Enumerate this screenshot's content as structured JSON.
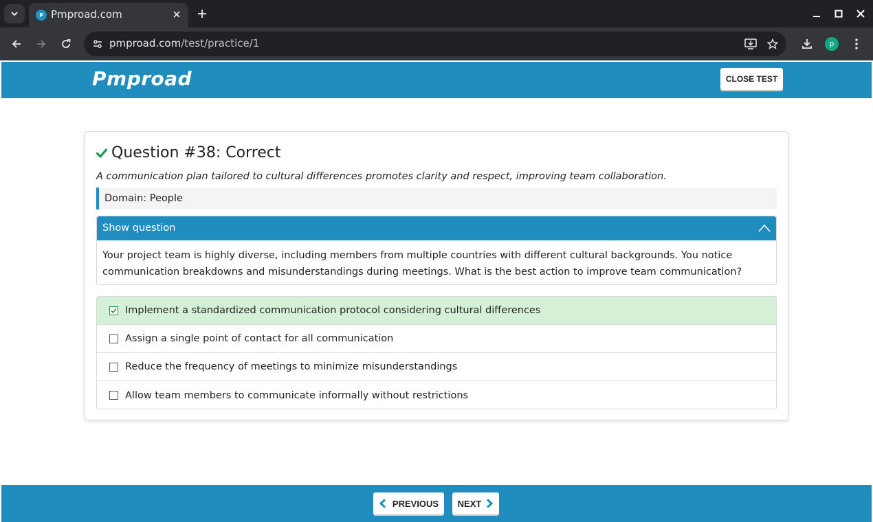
{
  "browser": {
    "tab_title": "Pmproad.com",
    "favicon_text": "P",
    "url_host": "pmproad.com",
    "url_path": "/test/practice/1",
    "profile_initial": "p"
  },
  "header": {
    "logo": "Pmproad",
    "close_test_label": "CLOSE TEST"
  },
  "result": {
    "title": "Question #38: Correct",
    "explanation": "A communication plan tailored to cultural differences promotes clarity and respect, improving team collaboration.",
    "domain": "Domain: People"
  },
  "question": {
    "toggle_label": "Show question",
    "text": "Your project team is highly diverse, including members from multiple countries with different cultural backgrounds. You notice communication breakdowns and misunderstandings during meetings. What is the best action to improve team communication?"
  },
  "answers": [
    {
      "text": "Implement a standardized communication protocol considering cultural differences",
      "selected": true,
      "correct": true
    },
    {
      "text": "Assign a single point of contact for all communication",
      "selected": false,
      "correct": false
    },
    {
      "text": "Reduce the frequency of meetings to minimize misunderstandings",
      "selected": false,
      "correct": false
    },
    {
      "text": "Allow team members to communicate informally without restrictions",
      "selected": false,
      "correct": false
    }
  ],
  "footer": {
    "previous_label": "PREVIOUS",
    "next_label": "NEXT"
  },
  "colors": {
    "brand": "#1f8dbe",
    "correct_bg": "#d4f0d6",
    "correct_check": "#1b9a4b"
  }
}
